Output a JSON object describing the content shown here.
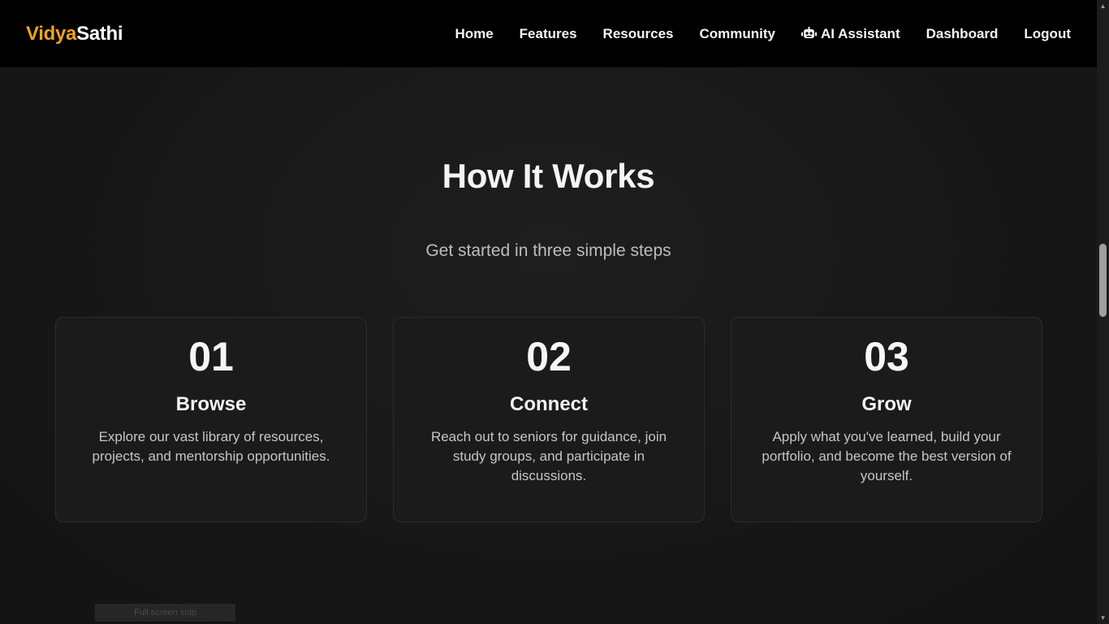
{
  "brand": {
    "part1": "Vidya",
    "part2": "Sathi"
  },
  "nav": {
    "home": "Home",
    "features": "Features",
    "resources": "Resources",
    "community": "Community",
    "ai_assistant": "AI Assistant",
    "dashboard": "Dashboard",
    "logout": "Logout"
  },
  "section": {
    "title": "How It Works",
    "subtitle": "Get started in three simple steps"
  },
  "steps": [
    {
      "number": "01",
      "title": "Browse",
      "description": "Explore our vast library of resources, projects, and mentorship opportunities."
    },
    {
      "number": "02",
      "title": "Connect",
      "description": "Reach out to seniors for guidance, join study groups, and participate in discussions."
    },
    {
      "number": "03",
      "title": "Grow",
      "description": "Apply what you've learned, build your portfolio, and become the best version of yourself."
    }
  ],
  "toast": {
    "text": "Full screen snip"
  },
  "colors": {
    "accent": "#f0a21c",
    "background": "#161616",
    "navbar": "#000000",
    "card": "#1b1b1b"
  },
  "icons": {
    "ai_assistant": "robot-icon"
  }
}
